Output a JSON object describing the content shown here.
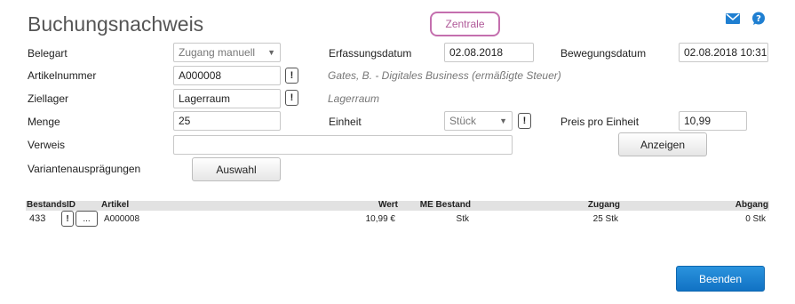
{
  "header": {
    "title": "Buchungsnachweis",
    "location_button": "Zentrale",
    "mail_icon": "envelope-icon",
    "help_icon": "question-bubble-icon",
    "accent": "#1f7fd1",
    "location_border": "#c46fae"
  },
  "form": {
    "belegart_label": "Belegart",
    "belegart_value": "Zugang manuell",
    "erfassungsdatum_label": "Erfassungsdatum",
    "erfassungsdatum_value": "02.08.2018",
    "bewegungsdatum_label": "Bewegungsdatum",
    "bewegungsdatum_value": "02.08.2018 10:31",
    "artikelnummer_label": "Artikelnummer",
    "artikelnummer_value": "A000008",
    "artikel_info": "Gates, B. - Digitales Business (ermäßigte Steuer)",
    "ziellager_label": "Ziellager",
    "ziellager_value": "Lagerraum",
    "ziellager_info": "Lagerraum",
    "menge_label": "Menge",
    "menge_value": "25",
    "einheit_label": "Einheit",
    "einheit_value": "Stück",
    "preis_label": "Preis pro Einheit",
    "preis_value": "10,99",
    "verweis_label": "Verweis",
    "verweis_value": "",
    "anzeigen_button": "Anzeigen",
    "varianten_label": "Variantenausprägungen",
    "auswahl_button": "Auswahl",
    "exclaim": "!"
  },
  "table": {
    "headers": [
      "BestandsID",
      "Artikel",
      "Wert",
      "ME Bestand",
      "Zugang",
      "Abgang"
    ],
    "rows": [
      {
        "id": "433",
        "detail_button": "...",
        "artikel": "A000008",
        "wert": "10,99 €",
        "me": "Stk",
        "zugang": "25 Stk",
        "abgang": "0 Stk"
      }
    ]
  },
  "footer": {
    "beenden_button": "Beenden",
    "button_color": "#1a7fd0"
  }
}
